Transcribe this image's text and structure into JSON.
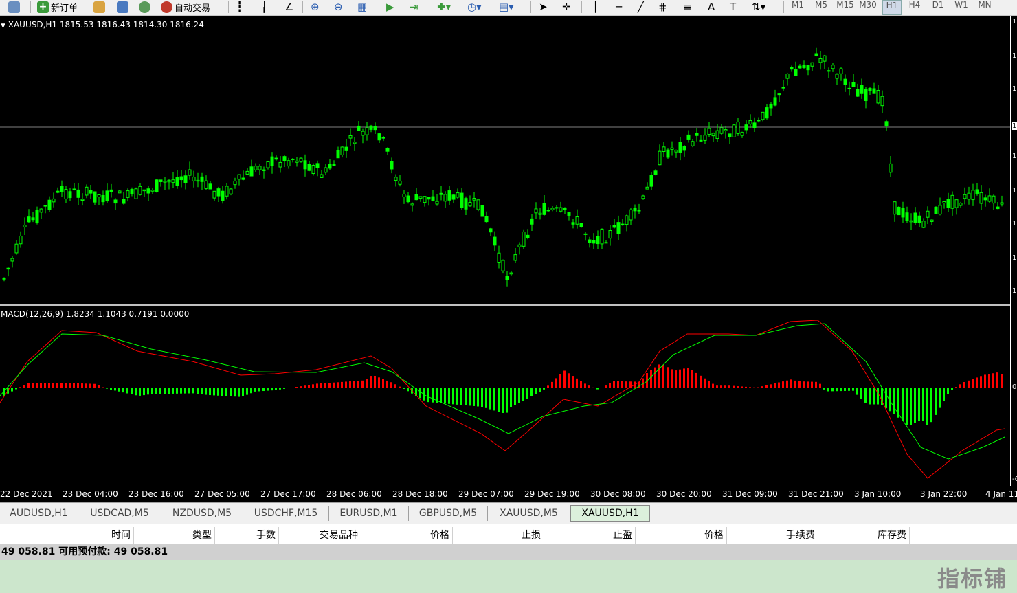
{
  "toolbar": {
    "new_order": "新订单",
    "auto_trading": "自动交易",
    "timeframes": [
      "M1",
      "M5",
      "M15",
      "M30",
      "H1",
      "H4",
      "D1",
      "W1",
      "MN"
    ]
  },
  "chart": {
    "title": "XAUUSD,H1  1815.53 1816.43 1814.30 1816.24",
    "colors": {
      "up": "#00ff00",
      "down": "#00ff00",
      "background": "#000000",
      "grid_line": "#808080"
    }
  },
  "macd": {
    "title": "MACD(12,26,9) 1.8234 1.1043 0.7191 0.0000",
    "colors": {
      "positive": "#ff0000",
      "negative": "#00ff00",
      "main": "#ff0000",
      "signal": "#00ff00"
    }
  },
  "x_axis": [
    "22 Dec 2021",
    "23 Dec 04:00",
    "23 Dec 16:00",
    "27 Dec 05:00",
    "27 Dec 17:00",
    "28 Dec 06:00",
    "28 Dec 18:00",
    "29 Dec 07:00",
    "29 Dec 19:00",
    "30 Dec 08:00",
    "30 Dec 20:00",
    "31 Dec 09:00",
    "31 Dec 21:00",
    "3 Jan 10:00",
    "3 Jan 22:00",
    "4 Jan 11"
  ],
  "right_axis": {
    "chart_marks": [
      "1",
      "1",
      "1",
      "1",
      "1",
      "1",
      "1",
      "1",
      "1"
    ],
    "macd_marks": [
      "0",
      "-6"
    ]
  },
  "tabs": [
    "AUDUSD,H1",
    "USDCAD,M5",
    "NZDUSD,M5",
    "USDCHF,M15",
    "EURUSD,M1",
    "GBPUSD,M5",
    "XAUUSD,M5",
    "XAUUSD,H1"
  ],
  "active_tab": "XAUUSD,H1",
  "terminal": {
    "columns": [
      "时间",
      "类型",
      "手数",
      "交易品种",
      "价格",
      "止损",
      "止盈",
      "价格",
      "手续费",
      "库存费"
    ],
    "balance_text": "49 058.81  可用预付款: 49 058.81"
  },
  "watermark": "指标铺"
}
